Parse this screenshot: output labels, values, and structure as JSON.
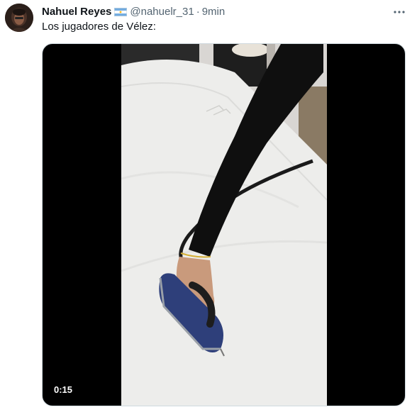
{
  "tweet": {
    "author": {
      "display_name": "Nahuel Reyes",
      "flag_icon": "argentina-flag-emoji",
      "handle": "@nahuelr_31",
      "separator": "·",
      "time": "9min"
    },
    "text": "Los jugadores de Vélez:",
    "media": {
      "type": "video",
      "duration": "0:15"
    },
    "icons": {
      "more": "ellipsis-icon"
    }
  },
  "colors": {
    "primary_text": "#0f1419",
    "secondary_text": "#536471",
    "media_background": "#000000",
    "flag_blue": "#74acdf",
    "flag_sun": "#f6b40e"
  }
}
